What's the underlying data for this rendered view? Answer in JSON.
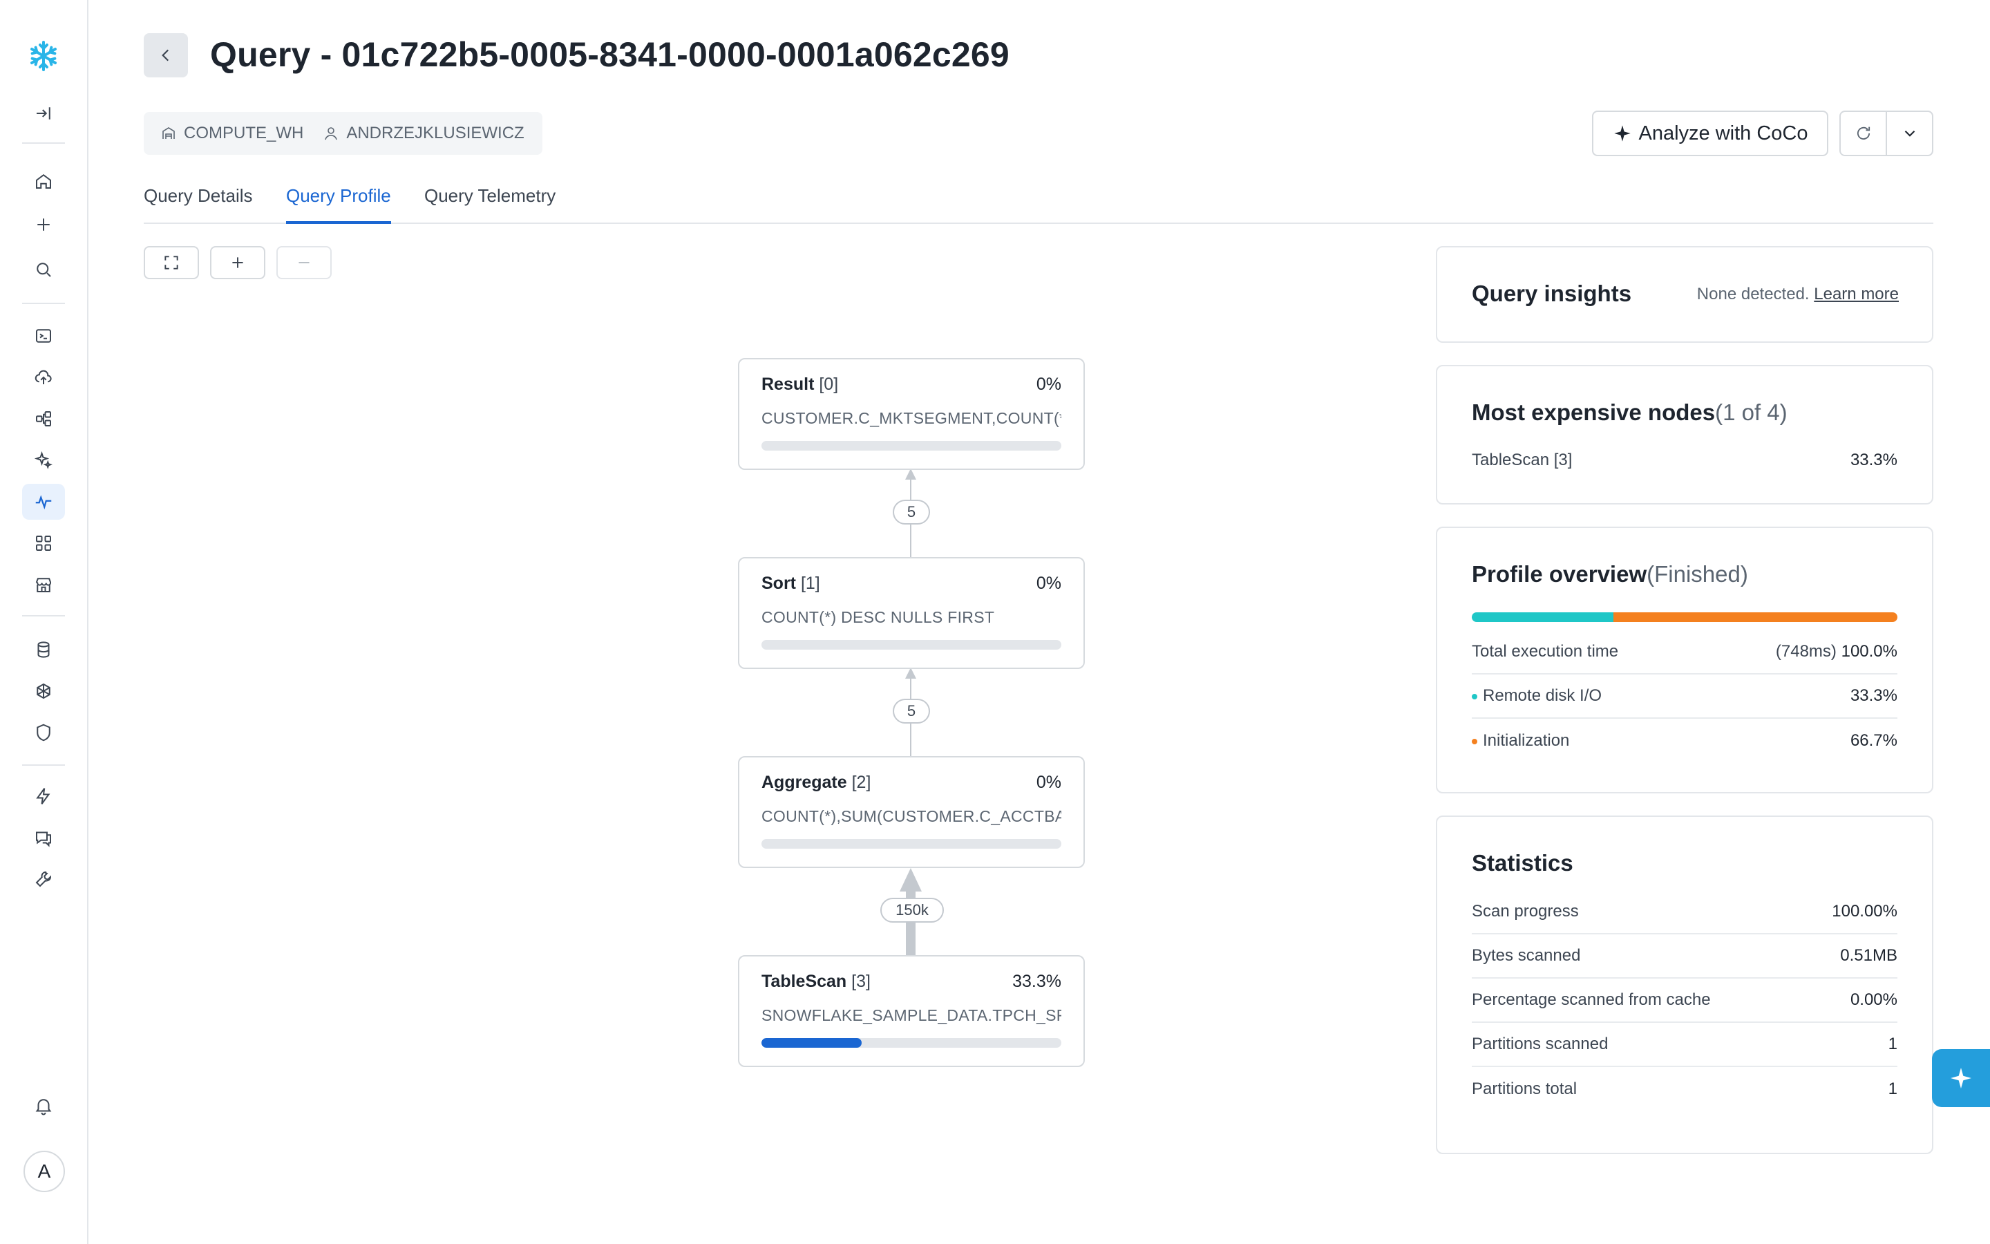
{
  "header": {
    "title": "Query - 01c722b5-0005-8341-0000-0001a062c269",
    "warehouse": "COMPUTE_WH",
    "user": "ANDRZEJKLUSIEWICZ",
    "analyze_label": "Analyze with CoCo"
  },
  "tabs": [
    {
      "label": "Query Details"
    },
    {
      "label": "Query Profile"
    },
    {
      "label": "Query Telemetry"
    }
  ],
  "avatar_initial": "A",
  "graph": {
    "nodes": [
      {
        "name": "Result",
        "id": "[0]",
        "pct": "0%",
        "desc": "CUSTOMER.C_MKTSEGMENT,COUNT(*...",
        "fill": 0
      },
      {
        "name": "Sort",
        "id": "[1]",
        "pct": "0%",
        "desc": "COUNT(*) DESC NULLS FIRST",
        "fill": 0
      },
      {
        "name": "Aggregate",
        "id": "[2]",
        "pct": "0%",
        "desc": "COUNT(*),SUM(CUSTOMER.C_ACCTBA...",
        "fill": 0
      },
      {
        "name": "TableScan",
        "id": "[3]",
        "pct": "33.3%",
        "desc": "SNOWFLAKE_SAMPLE_DATA.TPCH_SF1...",
        "fill": 0.333
      }
    ],
    "edges": [
      "5",
      "5",
      "150k"
    ]
  },
  "insights": {
    "title": "Query insights",
    "status": "None detected.",
    "link": "Learn more"
  },
  "expensive": {
    "title": "Most expensive nodes",
    "count": "(1 of 4)",
    "node": "TableScan [3]",
    "value": "33.3%"
  },
  "overview": {
    "title": "Profile overview",
    "state": "(Finished)",
    "total_label": "Total execution time",
    "total_ms": "(748ms)",
    "total_pct": "100.0%",
    "items": [
      {
        "label": "Remote disk I/O",
        "value": "33.3%",
        "fraction": 0.333,
        "color": "#1fc7c7"
      },
      {
        "label": "Initialization",
        "value": "66.7%",
        "fraction": 0.667,
        "color": "#f4801f"
      }
    ]
  },
  "statistics": {
    "title": "Statistics",
    "rows": [
      {
        "label": "Scan progress",
        "value": "100.00%"
      },
      {
        "label": "Bytes scanned",
        "value": "0.51MB"
      },
      {
        "label": "Percentage scanned from cache",
        "value": "0.00%"
      },
      {
        "label": "Partitions scanned",
        "value": "1"
      },
      {
        "label": "Partitions total",
        "value": "1"
      }
    ]
  },
  "colors": {
    "accent": "#1a66d2",
    "logo": "#29b5e8"
  }
}
